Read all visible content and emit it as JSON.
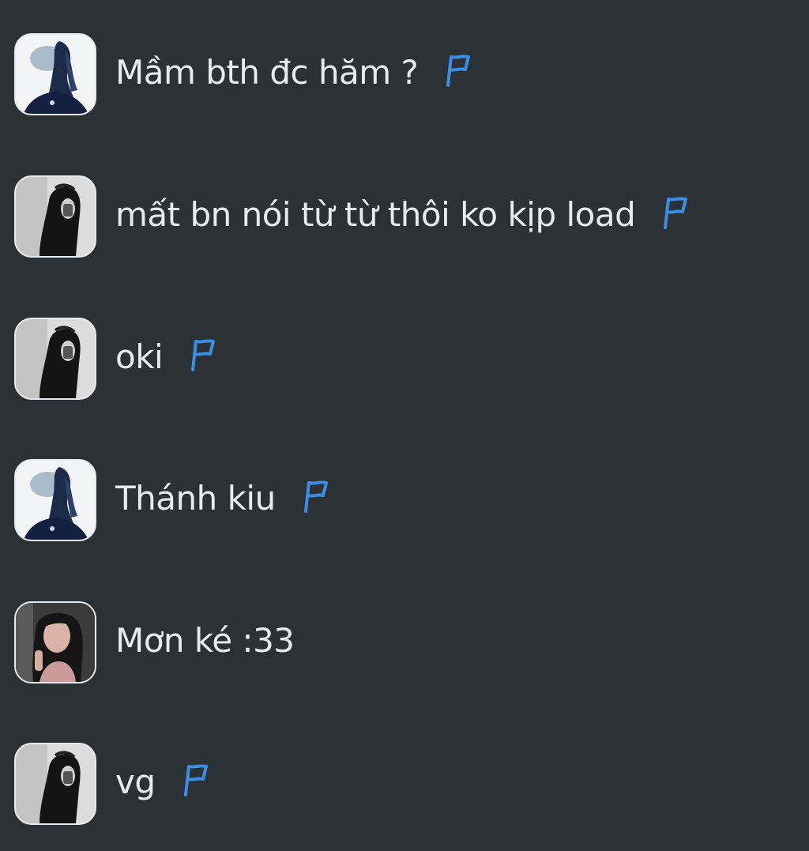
{
  "colors": {
    "background": "#2c3135",
    "text": "#e9ecef",
    "flag": "#3a8ee6",
    "avatar_border": "#e7eaec"
  },
  "messages": [
    {
      "avatar": "avatar-blue-silhouette",
      "text": "Mầm bth đc hăm ?",
      "flag": true
    },
    {
      "avatar": "avatar-girl-bw",
      "text": "mất bn nói từ từ thôi ko kịp load",
      "flag": true
    },
    {
      "avatar": "avatar-girl-bw",
      "text": "oki",
      "flag": true
    },
    {
      "avatar": "avatar-blue-silhouette",
      "text": "Thánh kiu",
      "flag": true
    },
    {
      "avatar": "avatar-girl-color",
      "text": "Mơn ké :33",
      "flag": false
    },
    {
      "avatar": "avatar-girl-bw",
      "text": "vg",
      "flag": true
    }
  ]
}
